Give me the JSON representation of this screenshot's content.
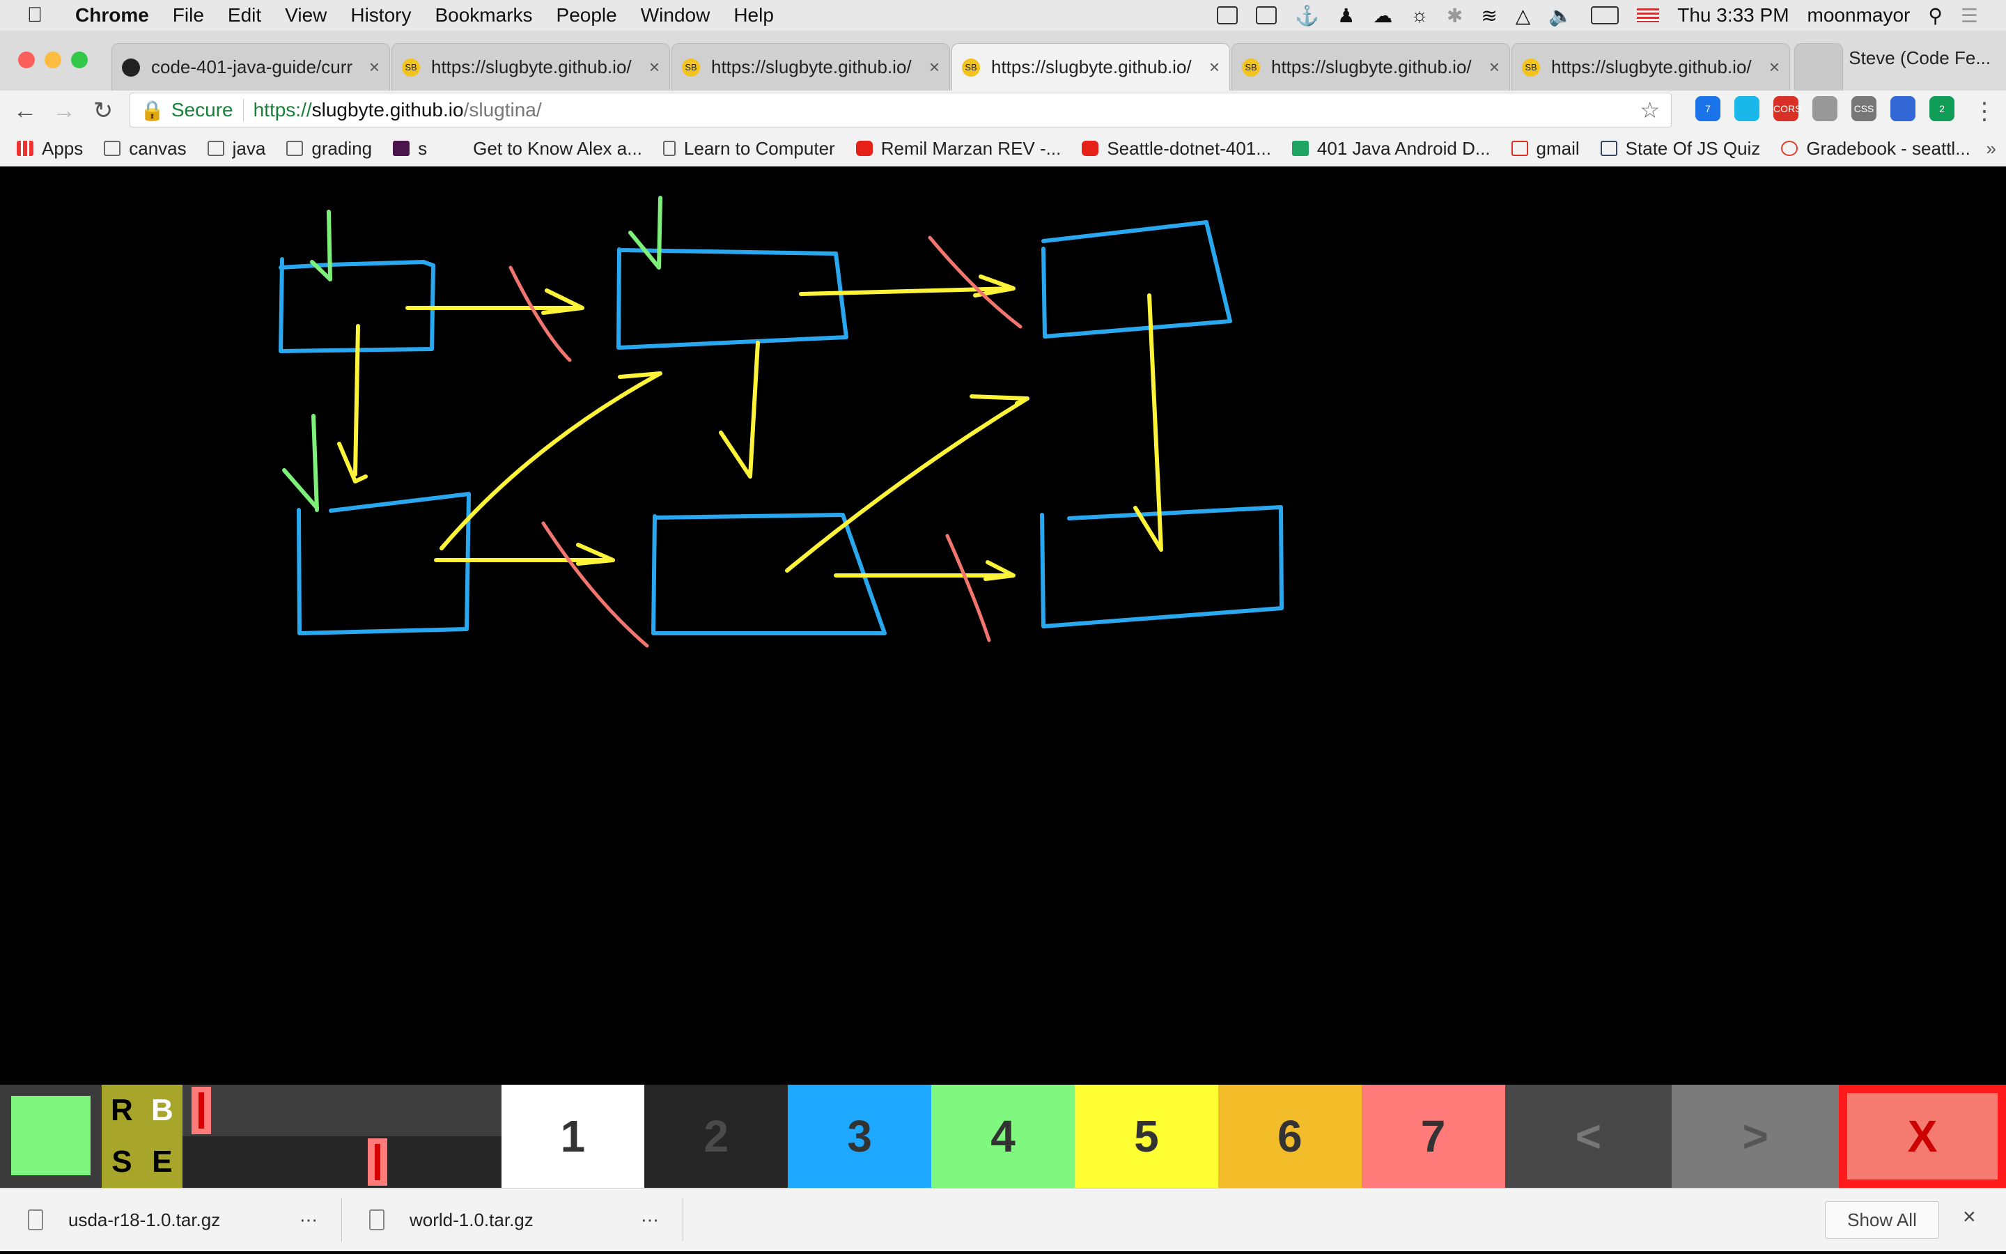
{
  "menubar": {
    "app_name": "Chrome",
    "menus": [
      "File",
      "Edit",
      "View",
      "History",
      "Bookmarks",
      "People",
      "Window",
      "Help"
    ],
    "clock": "Thu 3:33 PM",
    "user": "moonmayor"
  },
  "tabs": [
    {
      "title": "code-401-java-guide/curr",
      "icon": "github-icon",
      "active": false
    },
    {
      "title": "https://slugbyte.github.io/",
      "icon": "slugbyte-favicon",
      "active": false
    },
    {
      "title": "https://slugbyte.github.io/",
      "icon": "slugbyte-favicon",
      "active": false
    },
    {
      "title": "https://slugbyte.github.io/",
      "icon": "slugbyte-favicon",
      "active": true
    },
    {
      "title": "https://slugbyte.github.io/",
      "icon": "slugbyte-favicon",
      "active": false
    },
    {
      "title": "https://slugbyte.github.io/",
      "icon": "slugbyte-favicon",
      "active": false
    }
  ],
  "profile_name": "Steve (Code Fe...",
  "omnibox": {
    "secure_label": "Secure",
    "url_protocol": "https://",
    "url_host": "slugbyte.github.io",
    "url_path": "/slugtina/"
  },
  "extensions": [
    {
      "name": "extension-badge-7",
      "badge": "7",
      "color": "#1a73e8"
    },
    {
      "name": "extension-vimeo",
      "badge": "",
      "color": "#1ab7ea"
    },
    {
      "name": "extension-cors",
      "badge": "CORS",
      "color": "#d93025"
    },
    {
      "name": "extension-react",
      "badge": "",
      "color": "#999999"
    },
    {
      "name": "extension-css",
      "badge": "CSS",
      "color": "#777777"
    },
    {
      "name": "extension-device",
      "badge": "",
      "color": "#3367d6"
    },
    {
      "name": "extension-badge-2",
      "badge": "2",
      "color": "#0f9d58"
    }
  ],
  "bookmarks": [
    {
      "label": "Apps",
      "icon": "apps-grid-icon"
    },
    {
      "label": "canvas",
      "icon": "folder-icon"
    },
    {
      "label": "java",
      "icon": "folder-icon"
    },
    {
      "label": "grading",
      "icon": "folder-icon"
    },
    {
      "label": "s",
      "icon": "slack-icon"
    },
    {
      "label": "Get to Know Alex a...",
      "icon": "medium-icon"
    },
    {
      "label": "Learn to Computer",
      "icon": "page-icon"
    },
    {
      "label": "Remil Marzan REV -...",
      "icon": "youtube-icon"
    },
    {
      "label": "Seattle-dotnet-401...",
      "icon": "youtube-icon"
    },
    {
      "label": "401 Java Android D...",
      "icon": "sheets-icon"
    },
    {
      "label": "gmail",
      "icon": "gmail-icon"
    },
    {
      "label": "State Of JS Quiz",
      "icon": "tumblr-icon"
    },
    {
      "label": "Gradebook - seattl...",
      "icon": "canvas-icon"
    }
  ],
  "palette": {
    "current_color": "#7cf47e",
    "mode_letters": [
      "R",
      "B",
      "S",
      "E"
    ],
    "slider_top_value": 0.03,
    "slider_bottom_value": 0.62,
    "colors": [
      {
        "label": "1",
        "bg": "#ffffff",
        "fg": "#333333"
      },
      {
        "label": "2",
        "bg": "#262626",
        "fg": "#4a4a4a"
      },
      {
        "label": "3",
        "bg": "#1ea8ff",
        "fg": "#333333"
      },
      {
        "label": "4",
        "bg": "#80f77e",
        "fg": "#333333"
      },
      {
        "label": "5",
        "bg": "#ffff33",
        "fg": "#333333"
      },
      {
        "label": "6",
        "bg": "#f3bd2a",
        "fg": "#333333"
      },
      {
        "label": "7",
        "bg": "#ff7b79",
        "fg": "#333333"
      }
    ],
    "prev_label": "<",
    "next_label": ">",
    "clear_label": "X"
  },
  "drawing": {
    "stroke_colors": {
      "box": "#2aa8ef",
      "arrow": "#fdf43a",
      "entry": "#7df07a",
      "cross": "#f3756f"
    }
  },
  "downloads": {
    "items": [
      "usda-r18-1.0.tar.gz",
      "world-1.0.tar.gz"
    ],
    "show_all_label": "Show All"
  }
}
